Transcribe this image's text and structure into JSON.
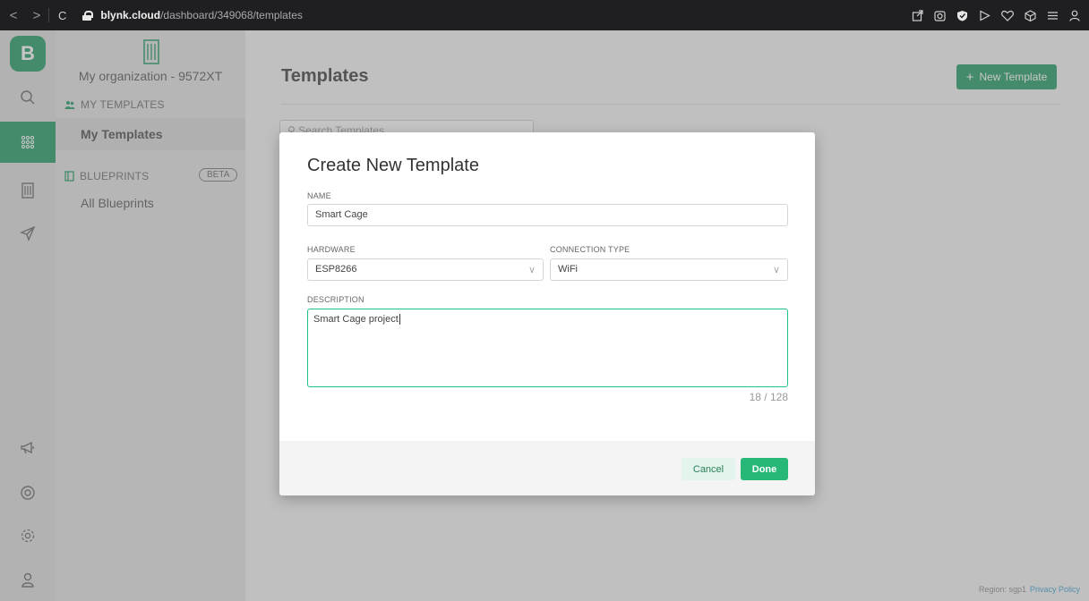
{
  "browser": {
    "nav_back": "<",
    "nav_forward": ">",
    "reload": "C",
    "url_host": "blynk.cloud",
    "url_path": "/dashboard/349068/templates"
  },
  "rail": {
    "logo": "B",
    "icons": [
      "search-icon",
      "templates-grid-icon",
      "organization-icon",
      "send-icon",
      "megaphone-icon",
      "help-lifebuoy-icon",
      "settings-icon",
      "user-icon"
    ]
  },
  "sidebar": {
    "org_name": "My organization - 9572XT",
    "my_templates_section": "MY TEMPLATES",
    "my_templates_link": "My Templates",
    "blueprints_section": "BLUEPRINTS",
    "beta_badge": "BETA",
    "all_blueprints_link": "All Blueprints"
  },
  "main": {
    "title": "Templates",
    "new_template_label": "New Template",
    "search_placeholder": "Search Templates",
    "region": "Region: sgp1",
    "privacy_policy": "Privacy Policy"
  },
  "modal": {
    "title": "Create New Template",
    "name_label": "NAME",
    "name_value": "Smart Cage",
    "hardware_label": "HARDWARE",
    "hardware_value": "ESP8266",
    "connection_label": "CONNECTION TYPE",
    "connection_value": "WiFi",
    "description_label": "DESCRIPTION",
    "description_value": "Smart Cage project",
    "counter": "18 / 128",
    "cancel_label": "Cancel",
    "done_label": "Done"
  },
  "colors": {
    "accent": "#1f9a62",
    "done": "#27b878",
    "focus_border": "#1ec28b"
  }
}
